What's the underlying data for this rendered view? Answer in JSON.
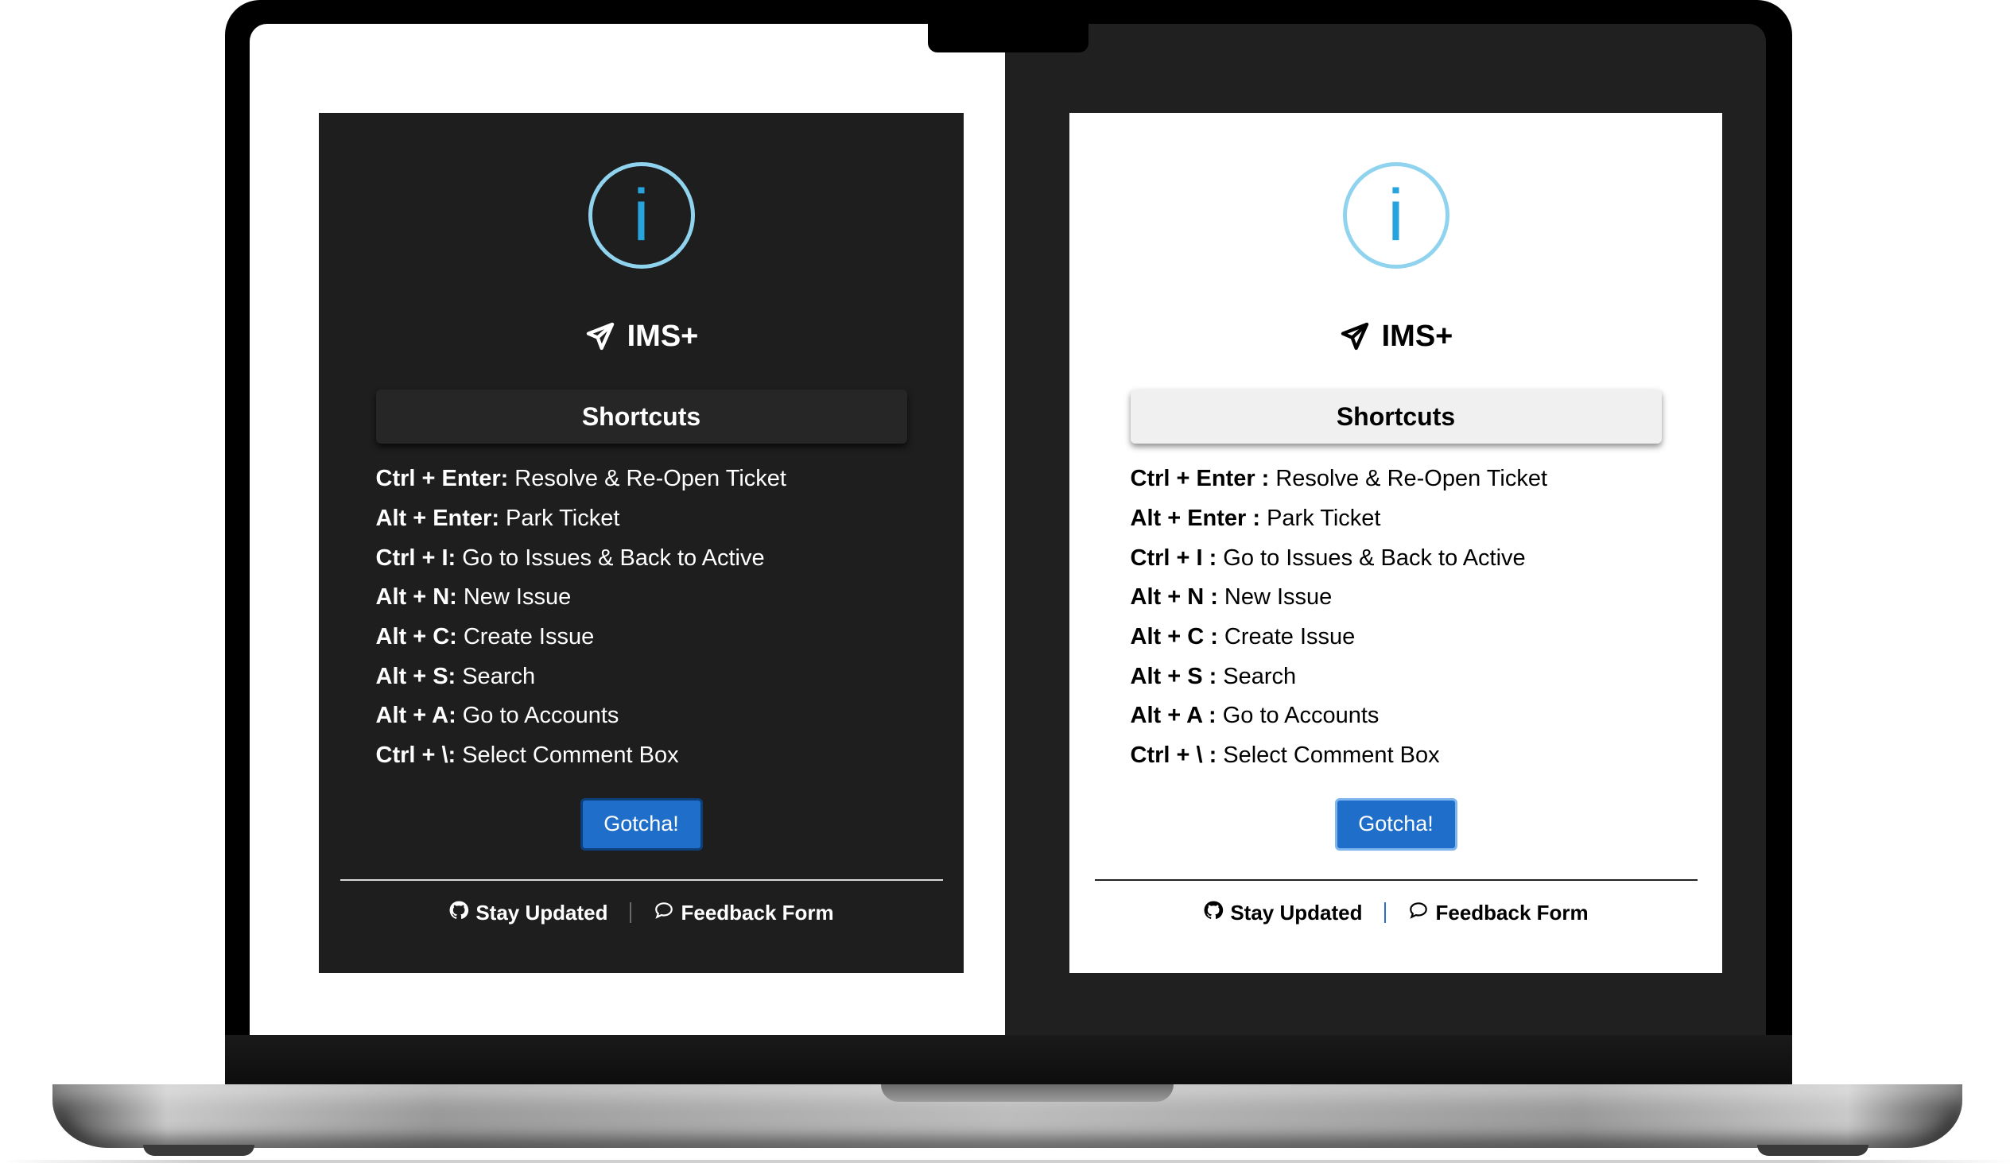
{
  "colors": {
    "accent": "#27a3de",
    "button": "#1f6fca",
    "dark_panel_bg": "#1e1e1e",
    "light_panel_bg": "#ffffff"
  },
  "dark_panel": {
    "info_icon_glyph": "i",
    "brand_icon": "send-icon",
    "brand_name": "IMS+",
    "header": "Shortcuts",
    "shortcuts": [
      {
        "keys": "Ctrl + Enter:",
        "action": "Resolve & Re-Open Ticket"
      },
      {
        "keys": "Alt + Enter:",
        "action": "Park Ticket"
      },
      {
        "keys": "Ctrl + I:",
        "action": "Go to Issues & Back to Active"
      },
      {
        "keys": "Alt + N:",
        "action": "New Issue"
      },
      {
        "keys": "Alt + C:",
        "action": "Create Issue"
      },
      {
        "keys": "Alt + S:",
        "action": "Search"
      },
      {
        "keys": "Alt + A:",
        "action": "Go to Accounts"
      },
      {
        "keys": "Ctrl + \\:",
        "action": "Select Comment Box"
      }
    ],
    "button_label": "Gotcha!",
    "footer": {
      "stay_updated": "Stay Updated",
      "feedback": "Feedback Form"
    }
  },
  "light_panel": {
    "info_icon_glyph": "i",
    "brand_icon": "send-icon",
    "brand_name": "IMS+",
    "header": "Shortcuts",
    "shortcuts": [
      {
        "keys": "Ctrl + Enter :",
        "action": "Resolve & Re-Open Ticket"
      },
      {
        "keys": "Alt + Enter :",
        "action": "Park Ticket"
      },
      {
        "keys": "Ctrl + I :",
        "action": "Go to Issues & Back to Active"
      },
      {
        "keys": "Alt + N :",
        "action": "New Issue"
      },
      {
        "keys": "Alt + C :",
        "action": "Create Issue"
      },
      {
        "keys": "Alt + S :",
        "action": "Search"
      },
      {
        "keys": "Alt + A :",
        "action": "Go to Accounts"
      },
      {
        "keys": "Ctrl + \\ :",
        "action": "Select Comment Box"
      }
    ],
    "button_label": "Gotcha!",
    "footer": {
      "stay_updated": "Stay Updated",
      "feedback": "Feedback Form"
    }
  }
}
